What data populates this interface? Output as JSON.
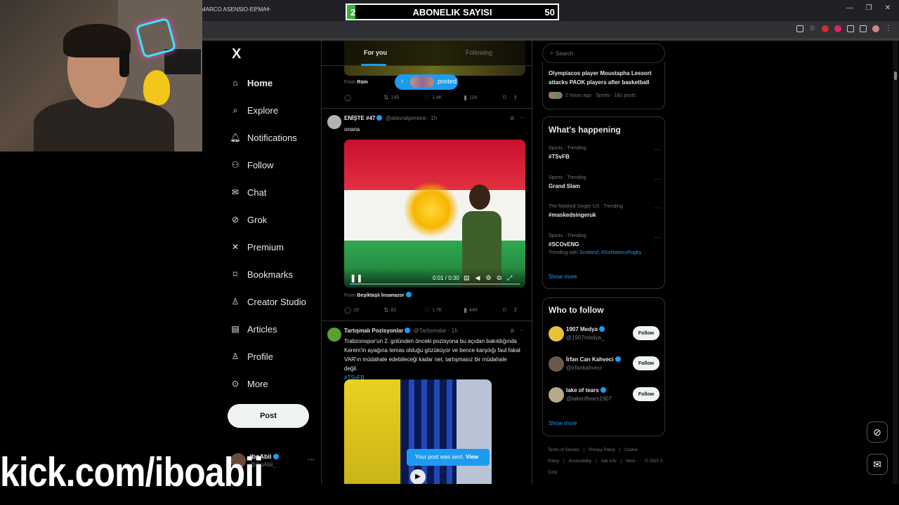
{
  "browser": {
    "tab_title": "MARCO ASENSIO-EL MA",
    "tab_close": "×",
    "new_tab": "+"
  },
  "overlay": {
    "subscriber_title": "ABONELIK SAYISI",
    "current": "2",
    "goal": "50",
    "progress": 0.04,
    "bar_color": "#35b53b",
    "stream_url": "kick.com/iboabii"
  },
  "nav": {
    "logo": "X",
    "items": [
      {
        "label": "Home",
        "icon": "home-icon"
      },
      {
        "label": "Explore",
        "icon": "search-icon"
      },
      {
        "label": "Notifications",
        "icon": "bell-icon"
      },
      {
        "label": "Follow",
        "icon": "person-add-icon"
      },
      {
        "label": "Chat",
        "icon": "mail-icon"
      },
      {
        "label": "Grok",
        "icon": "grok-icon"
      },
      {
        "label": "Premium",
        "icon": "x-icon"
      },
      {
        "label": "Bookmarks",
        "icon": "bookmark-icon"
      },
      {
        "label": "Creator Studio",
        "icon": "creator-icon"
      },
      {
        "label": "Articles",
        "icon": "article-icon"
      },
      {
        "label": "Profile",
        "icon": "person-icon"
      },
      {
        "label": "More",
        "icon": "more-circle-icon"
      }
    ],
    "post_button": "Post",
    "account": {
      "name": "IboAbii",
      "handle": "@IboAbii_",
      "more": "···"
    }
  },
  "timeline": {
    "tabs": {
      "for_you": "For you",
      "following": "Following"
    },
    "posted_pill": "posted",
    "first": {
      "from_label": "From",
      "from_name": "Rüm",
      "replies": "",
      "reposts": "145",
      "likes": "1.4K",
      "views": "11K"
    },
    "tweet1": {
      "name": "ENİŞTE #47",
      "handle": "@atavratpereira",
      "time": "· 1h",
      "text": "onana",
      "video_time": "0:01 / 0:30",
      "video_progress": 0.033,
      "from_label": "From",
      "from_name": "Beşiktaşlı İnsanazor",
      "replies": "19",
      "reposts": "82",
      "likes": "1.7K",
      "views": "44K"
    },
    "tweet2": {
      "name": "Tartışmalı Pozisyonlar",
      "handle": "@Tartismalar",
      "time": "· 1h",
      "text": "Trabzonspor'un 2. golünden önceki pozisyona bu açıdan bakıldığında Kerem'in ayağına temas olduğu gözüküyor ve bence karşılığı faul fakat VAR'ın müdahale edebileceği kadar net, tartışmasız bir müdahale değil.",
      "hashtag": "#TSvFB"
    },
    "toast": {
      "text": "Your post was sent.",
      "action": "View"
    }
  },
  "search": {
    "placeholder": "Search"
  },
  "news": {
    "title": "Olympiacos player Moustapha Lessort attacks PAOK players after basketball ...",
    "meta": "2 hours ago · Sports · 181 posts"
  },
  "whats_happening": {
    "title": "What's happening",
    "trends": [
      {
        "category": "Sports · Trending",
        "name": "#TSvFB",
        "with": ""
      },
      {
        "category": "Sports · Trending",
        "name": "Grand Slam",
        "with": ""
      },
      {
        "category": "The Masked Singer US · Trending",
        "name": "#maskedsingeruk",
        "with": ""
      },
      {
        "category": "Sports · Trending",
        "name": "#SCOvENG",
        "with_label": "Trending with",
        "with": "Scotland, #SixNationsRugby"
      }
    ],
    "show_more": "Show more"
  },
  "who_to_follow": {
    "title": "Who to follow",
    "accounts": [
      {
        "name": "1907 Medya",
        "handle": "@1907medya_",
        "button": "Follow"
      },
      {
        "name": "İrfan Can Kahveci",
        "handle": "@irfankahveci",
        "button": "Follow"
      },
      {
        "name": "lake of tears",
        "handle": "@lakeoftears1907",
        "button": "Follow"
      }
    ],
    "show_more": "Show more"
  },
  "footer": {
    "links": [
      "Terms of Service",
      "|",
      "Privacy Policy",
      "|",
      "Cookie Policy",
      "|",
      "Accessibility",
      "|",
      "Ads info",
      "|",
      "More ···",
      "© 2025 X Corp."
    ]
  },
  "colors": {
    "accent": "#1d9bf0",
    "background": "#000000",
    "border": "#2f3336"
  }
}
